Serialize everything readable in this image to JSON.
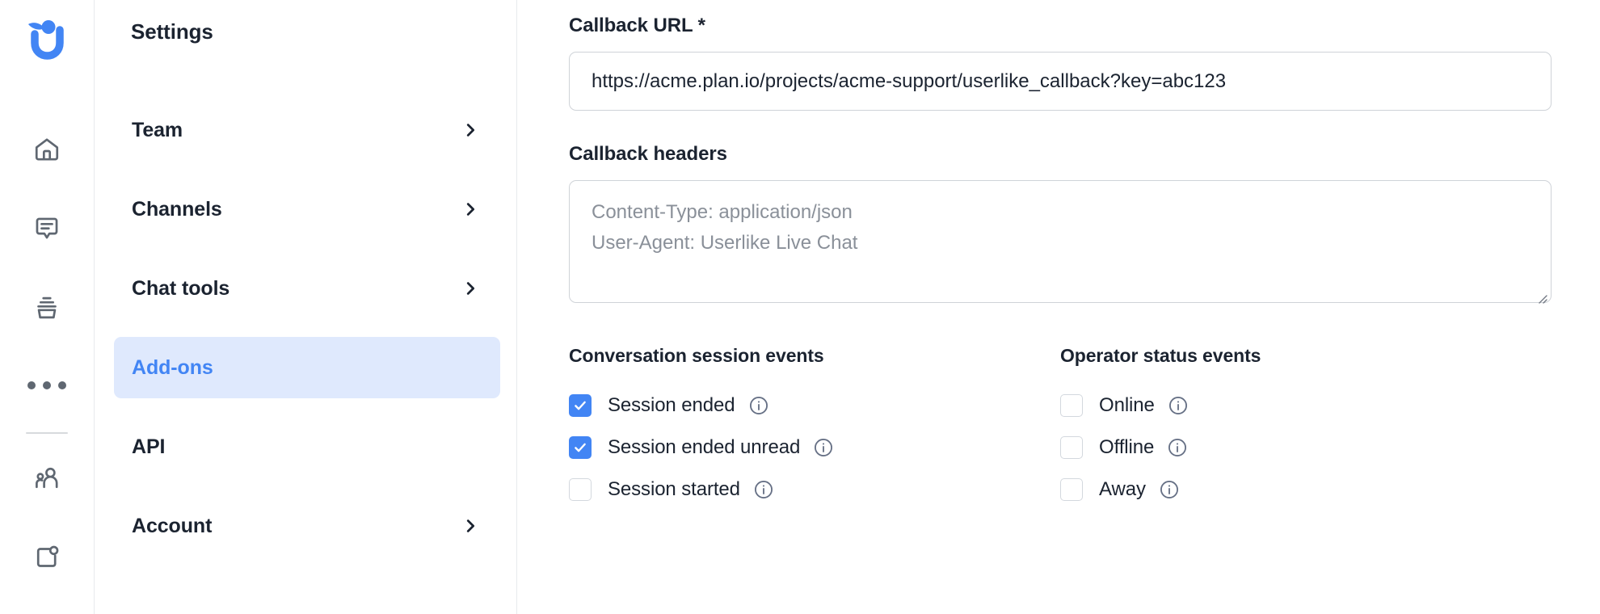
{
  "brand": {
    "logo_icon": "userlike-u-logo",
    "logo_color": "#4285f4"
  },
  "icon_rail": {
    "items": [
      {
        "icon": "home-icon",
        "name": "home"
      },
      {
        "icon": "message-bubble-icon",
        "name": "conversations"
      },
      {
        "icon": "archive-icon",
        "name": "archive"
      },
      {
        "icon": "more-dots-icon",
        "name": "more"
      },
      {
        "icon": "contacts-icon",
        "name": "contacts"
      },
      {
        "icon": "widget-icon",
        "name": "widget"
      }
    ]
  },
  "settings_nav": {
    "title": "Settings",
    "items": [
      {
        "label": "Team",
        "chevron": true,
        "active": false
      },
      {
        "label": "Channels",
        "chevron": true,
        "active": false
      },
      {
        "label": "Chat tools",
        "chevron": true,
        "active": false
      },
      {
        "label": "Add-ons",
        "chevron": false,
        "active": true
      },
      {
        "label": "API",
        "chevron": false,
        "active": false
      },
      {
        "label": "Account",
        "chevron": true,
        "active": false
      }
    ],
    "active_color": "#4285f4",
    "active_bg": "#dfe9fd"
  },
  "main": {
    "callback_url": {
      "label": "Callback URL *",
      "value": "https://acme.plan.io/projects/acme-support/userlike_callback?key=abc123",
      "placeholder": "https://"
    },
    "callback_headers": {
      "label": "Callback headers",
      "value": "",
      "placeholder": "Content-Type: application/json\nUser-Agent: Userlike Live Chat"
    },
    "event_groups": [
      {
        "heading": "Conversation session events",
        "options": [
          {
            "label": "Session ended",
            "checked": true,
            "info": "info-icon"
          },
          {
            "label": "Session ended unread",
            "checked": true,
            "info": "info-icon"
          },
          {
            "label": "Session started",
            "checked": false,
            "info": "info-icon"
          }
        ]
      },
      {
        "heading": "Operator status events",
        "options": [
          {
            "label": "Online",
            "checked": false,
            "info": "info-icon"
          },
          {
            "label": "Offline",
            "checked": false,
            "info": "info-icon"
          },
          {
            "label": "Away",
            "checked": false,
            "info": "info-icon"
          }
        ]
      }
    ]
  },
  "colors": {
    "accent": "#4285f4",
    "text": "#1b2330",
    "muted": "#8a9099",
    "border": "#cfd3d8",
    "rail_icon": "#5f6771"
  }
}
